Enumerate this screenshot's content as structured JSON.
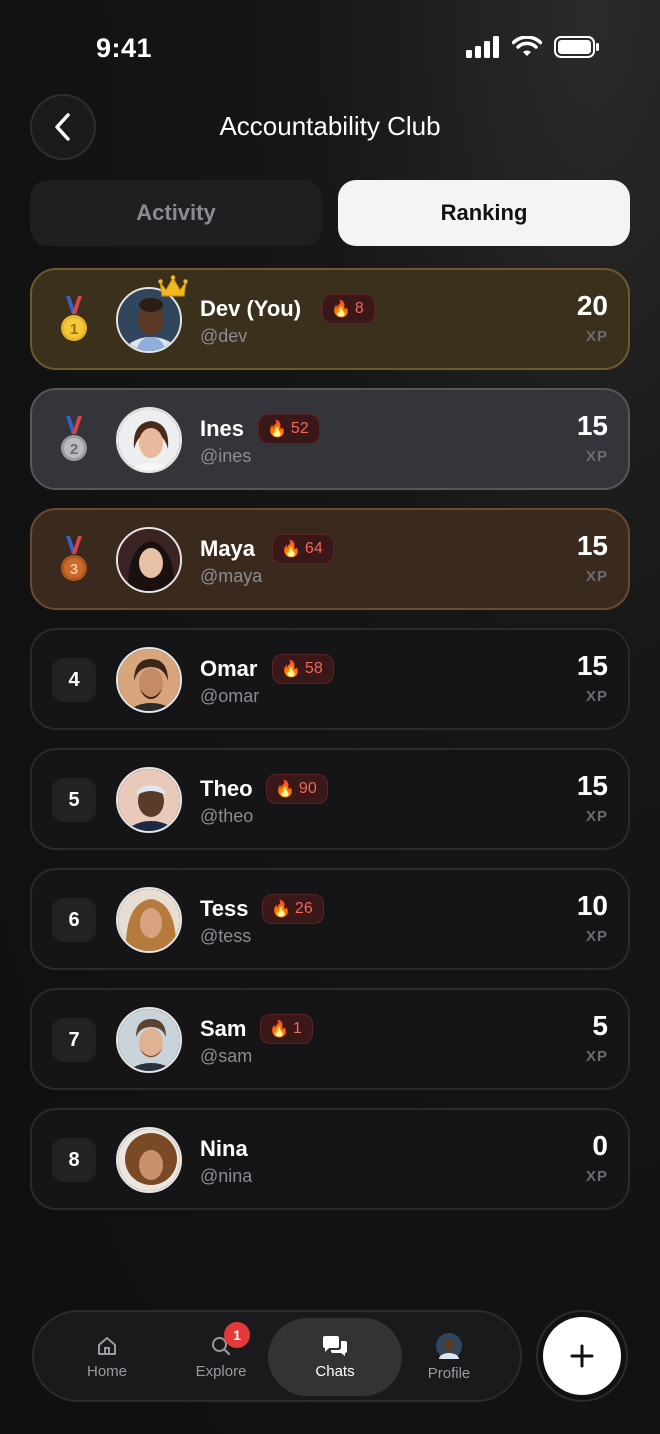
{
  "status_bar": {
    "time": "9:41"
  },
  "header": {
    "title": "Accountability Club"
  },
  "tabs": [
    {
      "label": "Activity",
      "active": false
    },
    {
      "label": "Ranking",
      "active": true
    }
  ],
  "rankings": [
    {
      "rank": "1",
      "name": "Dev (You)",
      "handle": "@dev",
      "streak": "8",
      "xp": "20",
      "xp_label": "XP",
      "medal": "gold",
      "crown": true
    },
    {
      "rank": "2",
      "name": "Ines",
      "handle": "@ines",
      "streak": "52",
      "xp": "15",
      "xp_label": "XP",
      "medal": "silver"
    },
    {
      "rank": "3",
      "name": "Maya",
      "handle": "@maya",
      "streak": "64",
      "xp": "15",
      "xp_label": "XP",
      "medal": "bronze"
    },
    {
      "rank": "4",
      "name": "Omar",
      "handle": "@omar",
      "streak": "58",
      "xp": "15",
      "xp_label": "XP"
    },
    {
      "rank": "5",
      "name": "Theo",
      "handle": "@theo",
      "streak": "90",
      "xp": "15",
      "xp_label": "XP"
    },
    {
      "rank": "6",
      "name": "Tess",
      "handle": "@tess",
      "streak": "26",
      "xp": "10",
      "xp_label": "XP"
    },
    {
      "rank": "7",
      "name": "Sam",
      "handle": "@sam",
      "streak": "1",
      "xp": "5",
      "xp_label": "XP"
    },
    {
      "rank": "8",
      "name": "Nina",
      "handle": "@nina",
      "streak": "",
      "xp": "0",
      "xp_label": "XP"
    }
  ],
  "nav": {
    "items": [
      {
        "label": "Home",
        "icon": "home-icon"
      },
      {
        "label": "Explore",
        "icon": "search-icon",
        "badge": "1"
      },
      {
        "label": "Chats",
        "icon": "chats-icon",
        "active": true
      },
      {
        "label": "Profile",
        "icon": "avatar"
      }
    ]
  },
  "colors": {
    "gold_row": "#3b301b",
    "silver_row": "#33353a",
    "bronze_row": "#3a2a1e",
    "streak_text": "#ef6a5a",
    "badge": "#e5383b"
  }
}
